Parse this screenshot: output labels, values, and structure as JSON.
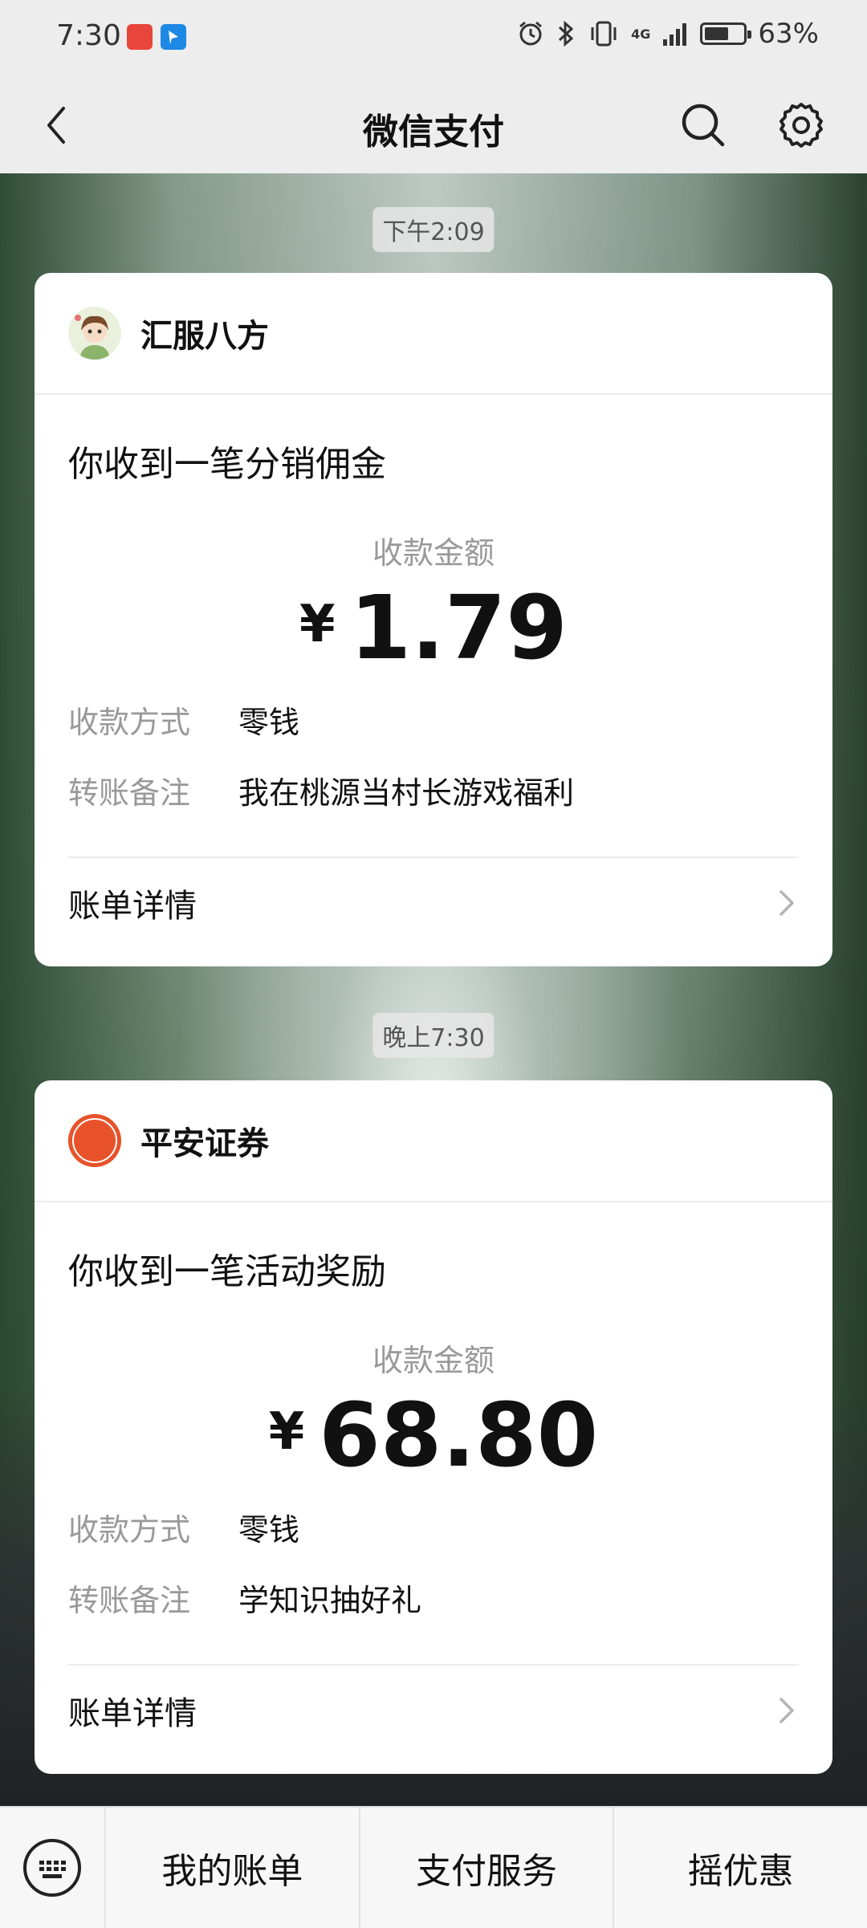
{
  "status_bar": {
    "time": "7:30",
    "battery_text": "63%",
    "battery_level": 0.63,
    "network": "4G",
    "icons": [
      "huawei-app-icon",
      "feishu-app-icon",
      "alarm-icon",
      "bluetooth-icon",
      "vibrate-icon",
      "signal-icon",
      "battery-icon"
    ]
  },
  "header": {
    "title": "微信支付"
  },
  "messages": [
    {
      "timestamp": "下午2:09",
      "merchant": "汇服八方",
      "headline": "你收到一笔分销佣金",
      "amount_label": "收款金额",
      "currency": "¥",
      "amount": "1.79",
      "method_label": "收款方式",
      "method_value": "零钱",
      "note_label": "转账备注",
      "note_value": "我在桃源当村长游戏福利",
      "detail_label": "账单详情"
    },
    {
      "timestamp": "晚上7:30",
      "merchant": "平安证券",
      "merchant_logo_text": "平安证券",
      "headline": "你收到一笔活动奖励",
      "amount_label": "收款金额",
      "currency": "¥",
      "amount": "68.80",
      "method_label": "收款方式",
      "method_value": "零钱",
      "note_label": "转账备注",
      "note_value": "学知识抽好礼",
      "detail_label": "账单详情"
    }
  ],
  "bottom_menu": {
    "items": [
      "我的账单",
      "支付服务",
      "摇优惠"
    ]
  },
  "colors": {
    "pingan_orange": "#e8522a",
    "text_primary": "#111111",
    "text_secondary": "#999999"
  }
}
